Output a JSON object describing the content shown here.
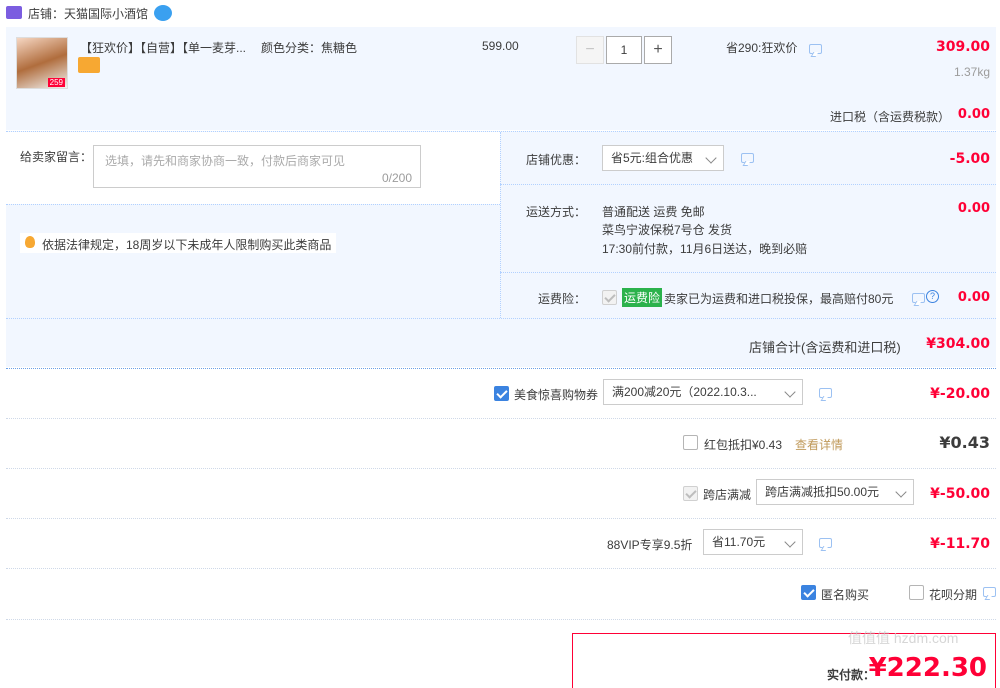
{
  "shop": {
    "label": "店铺：天猫国际小酒馆"
  },
  "item": {
    "title": "【狂欢价】【自营】【单一麦芽...",
    "color_label": "颜色分类：焦糖色",
    "thumb_price": "259",
    "unit_price": "599.00",
    "quantity": "1",
    "minus": "−",
    "plus": "+",
    "promo": "省290:狂欢价",
    "total": "309.00",
    "weight": "1.37kg"
  },
  "import_tax": {
    "label": "进口税（含运费税款）",
    "value": "0.00"
  },
  "message": {
    "label": "给卖家留言：",
    "placeholder": "选填，请先和商家协商一致，付款后商家可见",
    "counter": "0/200"
  },
  "law_notice": "依据法律规定，18周岁以下未成年人限制购买此类商品",
  "shop_discount": {
    "label": "店铺优惠：",
    "selected": "省5元:组合优惠",
    "value": "-5.00"
  },
  "shipping": {
    "label": "运送方式：",
    "line1": "普通配送 运费 免邮",
    "line2": "菜鸟宁波保税7号仓  发货",
    "line3": "17:30前付款，11月6日送达，晚到必赔",
    "value": "0.00"
  },
  "insurance": {
    "label": "运费险：",
    "badge": "运费险",
    "text": "卖家已为运费和进口税投保，最高赔付80元",
    "value": "0.00"
  },
  "shop_total": {
    "label": "店铺合计(含运费和进口税)",
    "value": "¥304.00"
  },
  "coupon": {
    "label": "美食惊喜购物券",
    "selected": "满200减20元（2022.10.3...",
    "value": "¥-20.00"
  },
  "redpacket": {
    "label": "红包抵扣¥0.43",
    "link": "查看详情",
    "value": "¥0.43"
  },
  "cross_store": {
    "label": "跨店满减",
    "selected": "跨店满减抵扣50.00元",
    "value": "¥-50.00"
  },
  "vip": {
    "label": "88VIP专享9.5折",
    "selected": "省11.70元",
    "value": "¥-11.70"
  },
  "anonymous": {
    "label": "匿名购买"
  },
  "huabei": {
    "label": "花呗分期"
  },
  "pay": {
    "label": "实付款：",
    "value": "¥222.30"
  },
  "watermark": "值值值 hzdm.com",
  "colors": {
    "accent_red": "#ff0036",
    "blue_bg": "#f2f7ff",
    "checkbox_blue": "#3b83e0",
    "green_badge": "#2bb24c"
  }
}
